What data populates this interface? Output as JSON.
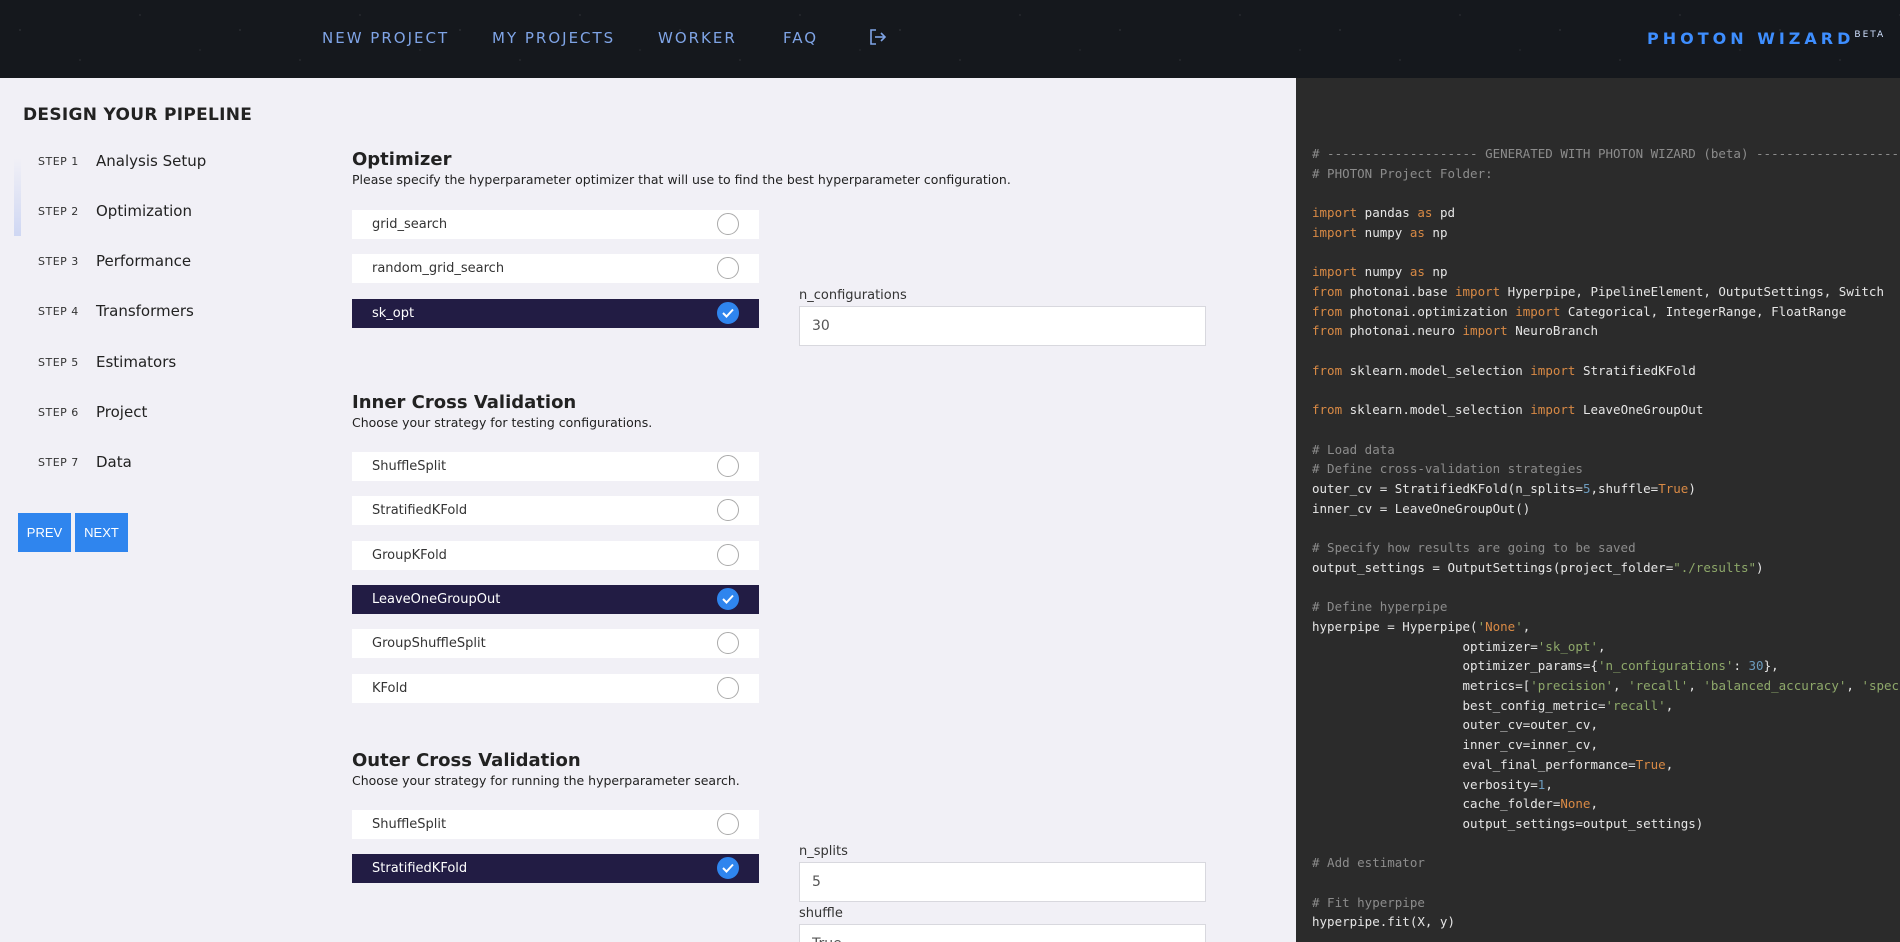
{
  "nav": {
    "items": [
      "NEW PROJECT",
      "MY PROJECTS",
      "WORKER",
      "FAQ"
    ],
    "logout_icon": "logout-icon",
    "brand": "PHOTON WIZARD",
    "brand_sup": "BETA"
  },
  "sidebar": {
    "title": "DESIGN YOUR PIPELINE",
    "steps": [
      {
        "num": "STEP 1",
        "label": "Analysis Setup"
      },
      {
        "num": "STEP 2",
        "label": "Optimization"
      },
      {
        "num": "STEP 3",
        "label": "Performance"
      },
      {
        "num": "STEP 4",
        "label": "Transformers"
      },
      {
        "num": "STEP 5",
        "label": "Estimators"
      },
      {
        "num": "STEP 6",
        "label": "Project"
      },
      {
        "num": "STEP 7",
        "label": "Data"
      }
    ],
    "prev_label": "PREV",
    "next_label": "NEXT"
  },
  "optimizer": {
    "title": "Optimizer",
    "desc": "Please specify the hyperparameter optimizer that will use to find the best hyperparameter configuration.",
    "options": [
      "grid_search",
      "random_grid_search",
      "sk_opt"
    ],
    "selected": "sk_opt",
    "n_configurations_label": "n_configurations",
    "n_configurations_value": "30"
  },
  "inner_cv": {
    "title": "Inner Cross Validation",
    "desc": "Choose your strategy for testing configurations.",
    "options": [
      "ShuffleSplit",
      "StratifiedKFold",
      "GroupKFold",
      "LeaveOneGroupOut",
      "GroupShuffleSplit",
      "KFold"
    ],
    "selected": "LeaveOneGroupOut"
  },
  "outer_cv": {
    "title": "Outer Cross Validation",
    "desc": "Choose your strategy for running the hyperparameter search.",
    "options": [
      "ShuffleSplit",
      "StratifiedKFold"
    ],
    "selected": "StratifiedKFold",
    "n_splits_label": "n_splits",
    "n_splits_value": "5",
    "shuffle_label": "shuffle",
    "shuffle_value": "True"
  },
  "code": {
    "lines": [
      "# -------------------- GENERATED WITH PHOTON WIZARD (beta) ------------------------------",
      "# PHOTON Project Folder:",
      "",
      "import pandas as pd",
      "import numpy as np",
      "",
      "import numpy as np",
      "from photonai.base import Hyperpipe, PipelineElement, OutputSettings, Switch",
      "from photonai.optimization import Categorical, IntegerRange, FloatRange",
      "from photonai.neuro import NeuroBranch",
      "",
      "from sklearn.model_selection import StratifiedKFold",
      "",
      "from sklearn.model_selection import LeaveOneGroupOut",
      "",
      "# Load data",
      "# Define cross-validation strategies",
      "outer_cv = StratifiedKFold(n_splits=5,shuffle=True)",
      "inner_cv = LeaveOneGroupOut()",
      "",
      "# Specify how results are going to be saved",
      "output_settings = OutputSettings(project_folder=\"./results\")",
      "",
      "# Define hyperpipe",
      "hyperpipe = Hyperpipe('None',",
      "                    optimizer='sk_opt',",
      "                    optimizer_params={'n_configurations': 30},",
      "                    metrics=['precision', 'recall', 'balanced_accuracy', 'specificity'],",
      "                    best_config_metric='recall',",
      "                    outer_cv=outer_cv,",
      "                    inner_cv=inner_cv,",
      "                    eval_final_performance=True,",
      "                    verbosity=1,",
      "                    cache_folder=None,",
      "                    output_settings=output_settings)",
      "",
      "# Add estimator",
      "",
      "# Fit hyperpipe",
      "hyperpipe.fit(X, y)"
    ]
  }
}
